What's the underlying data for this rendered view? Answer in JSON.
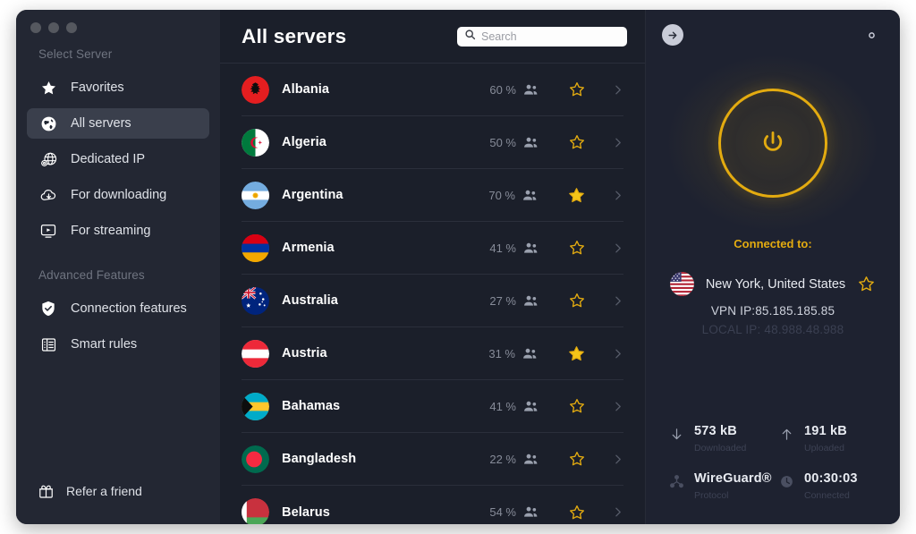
{
  "window": {
    "traffic_lights": [
      "close",
      "minimize",
      "maximize"
    ]
  },
  "sidebar": {
    "section_server": "Select Server",
    "section_advanced": "Advanced Features",
    "items": [
      {
        "label": "Favorites",
        "icon": "star-icon",
        "active": false
      },
      {
        "label": "All servers",
        "icon": "globe-icon",
        "active": true
      },
      {
        "label": "Dedicated IP",
        "icon": "globe-gear-icon",
        "active": false
      },
      {
        "label": "For downloading",
        "icon": "cloud-download-icon",
        "active": false
      },
      {
        "label": "For streaming",
        "icon": "monitor-play-icon",
        "active": false
      }
    ],
    "advanced_items": [
      {
        "label": "Connection features",
        "icon": "shield-check-icon"
      },
      {
        "label": "Smart rules",
        "icon": "rules-grid-icon"
      }
    ],
    "refer": {
      "label": "Refer a friend",
      "icon": "gift-icon"
    }
  },
  "server_list": {
    "title": "All servers",
    "search": {
      "placeholder": "Search",
      "value": "",
      "icon": "search-icon"
    },
    "rows": [
      {
        "country": "Albania",
        "load": "60 %",
        "favorite": false
      },
      {
        "country": "Algeria",
        "load": "50 %",
        "favorite": false
      },
      {
        "country": "Argentina",
        "load": "70 %",
        "favorite": true
      },
      {
        "country": "Armenia",
        "load": "41 %",
        "favorite": false
      },
      {
        "country": "Australia",
        "load": "27 %",
        "favorite": false
      },
      {
        "country": "Austria",
        "load": "31 %",
        "favorite": true
      },
      {
        "country": "Bahamas",
        "load": "41 %",
        "favorite": false
      },
      {
        "country": "Bangladesh",
        "load": "22 %",
        "favorite": false
      },
      {
        "country": "Belarus",
        "load": "54 %",
        "favorite": false
      }
    ]
  },
  "connection_panel": {
    "back_icon": "arrow-right-circle-icon",
    "settings_icon": "gear-icon",
    "power_icon": "power-icon",
    "power_state": "connected",
    "connected_label": "Connected to:",
    "location": "New York, United States",
    "location_favorite": false,
    "vpn_ip": "VPN IP:85.185.185.85",
    "local_ip": "LOCAL IP: 48.988.48.988",
    "stats": [
      {
        "icon": "arrow-down-icon",
        "value": "573 kB",
        "caption": "Downloaded"
      },
      {
        "icon": "arrow-up-icon",
        "value": "191 kB",
        "caption": "Uploaded"
      },
      {
        "icon": "protocol-icon",
        "value": "WireGuard®",
        "caption": "Protocol"
      },
      {
        "icon": "clock-icon",
        "value": "00:30:03",
        "caption": "Connected"
      }
    ]
  },
  "colors": {
    "accent": "#e3ab10",
    "window_bg": "#1b1f2a",
    "sidebar_bg": "#232733",
    "panel_bg": "#1e2230",
    "active_item": "#3a3f4c",
    "text_primary": "#ffffff",
    "text_muted": "#878c99"
  }
}
